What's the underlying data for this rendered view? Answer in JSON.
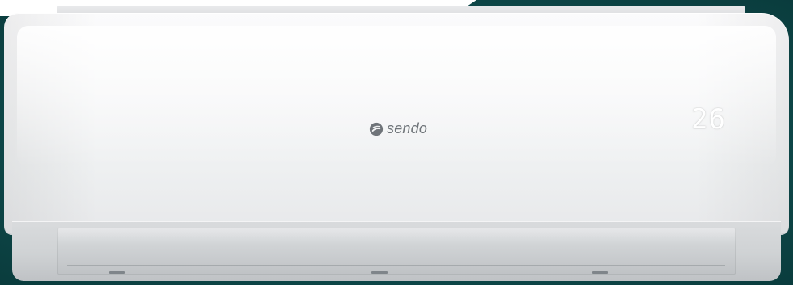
{
  "product": {
    "brand": "sendo",
    "temperature_display": "26"
  },
  "colors": {
    "background_teal": "#0f4b4c",
    "panel_white": "#f3f4f5",
    "body_gray": "#cfd2d4",
    "logo_gray": "#6f7479"
  },
  "icons": {
    "brand_logo": "sendo-logo-icon"
  }
}
